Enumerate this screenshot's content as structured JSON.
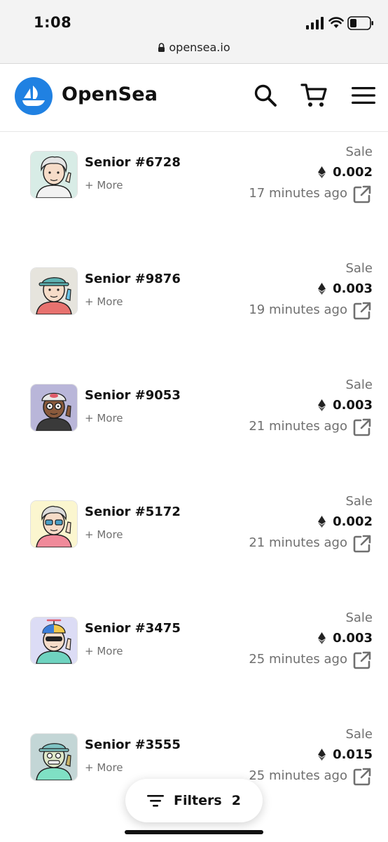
{
  "status_bar": {
    "time": "1:08",
    "url": "opensea.io"
  },
  "header": {
    "brand": "OpenSea"
  },
  "items": [
    {
      "name": "Senior #6728",
      "more": "+ More",
      "sale": "Sale",
      "price": "0.002",
      "time": "17 minutes ago",
      "bg": "#d8ece6"
    },
    {
      "name": "Senior #9876",
      "more": "+ More",
      "sale": "Sale",
      "price": "0.003",
      "time": "19 minutes ago",
      "bg": "#e6e4dd"
    },
    {
      "name": "Senior #9053",
      "more": "+ More",
      "sale": "Sale",
      "price": "0.003",
      "time": "21 minutes ago",
      "bg": "#b9b6d9"
    },
    {
      "name": "Senior #5172",
      "more": "+ More",
      "sale": "Sale",
      "price": "0.002",
      "time": "21 minutes ago",
      "bg": "#fbf6cf"
    },
    {
      "name": "Senior #3475",
      "more": "+ More",
      "sale": "Sale",
      "price": "0.003",
      "time": "25 minutes ago",
      "bg": "#dcdcf5"
    },
    {
      "name": "Senior #3555",
      "more": "+ More",
      "sale": "Sale",
      "price": "0.015",
      "time": "25 minutes ago",
      "bg": "#c3d6d6"
    }
  ],
  "filters": {
    "label": "Filters",
    "count": "2"
  },
  "colors": {
    "brand": "#2081e2",
    "muted": "#707070",
    "text": "#111111"
  },
  "icons": {
    "logo": "opensea-logo-icon",
    "search": "search-icon",
    "cart": "cart-icon",
    "menu": "hamburger-menu-icon",
    "price": "ethereum-icon",
    "link": "external-link-icon",
    "filter": "filter-icon"
  }
}
